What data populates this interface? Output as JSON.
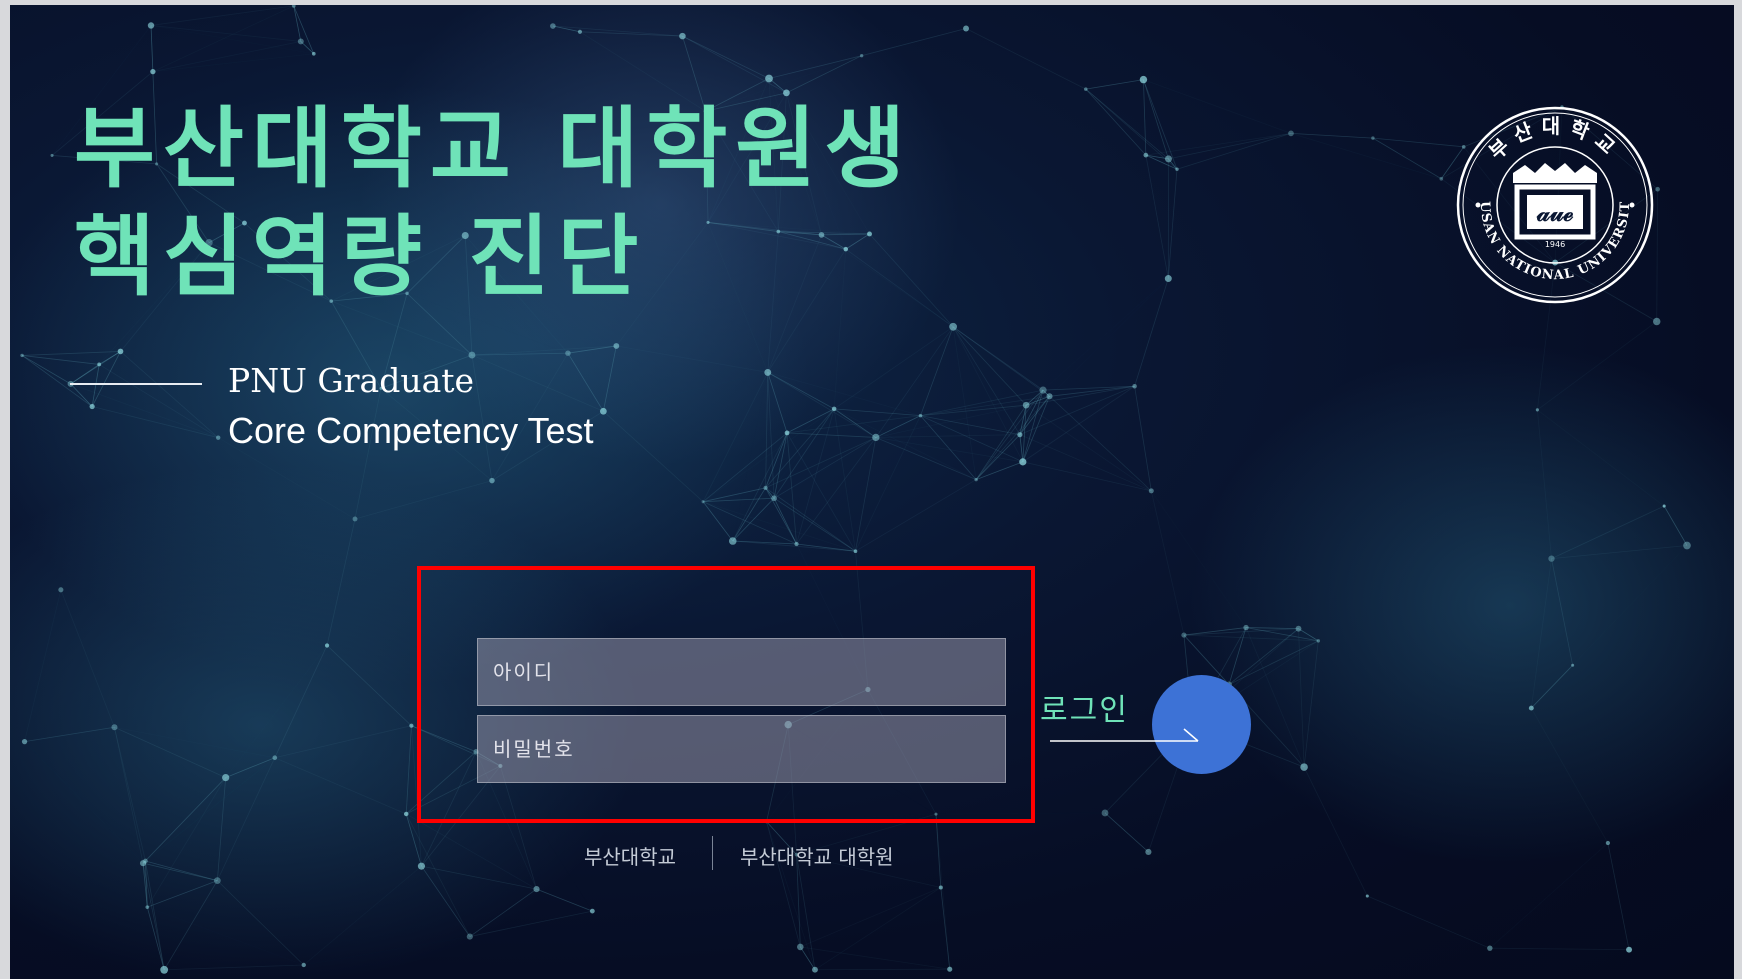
{
  "header": {
    "title_line_1": "부산대학교 대학원생",
    "title_line_2": "핵심역량 진단",
    "subtitle_en_1": "PNU Graduate",
    "subtitle_en_2": "Core Competency Test"
  },
  "logo": {
    "ring_text_top": "부산대학교",
    "ring_text_bottom": "PUSAN NATIONAL UNIVERSITY",
    "emblem_text": "𝒶𝓊ℯ",
    "year": "1946",
    "icon": "university-seal"
  },
  "login": {
    "id_placeholder": "아이디",
    "password_placeholder": "비밀번호",
    "button_label": "로그인"
  },
  "footer": {
    "links": [
      "부산대학교",
      "부산대학교 대학원"
    ]
  },
  "colors": {
    "title": "#6fe3b8",
    "button_circle": "#3d72d6",
    "highlight_border": "#ff0000",
    "background": "#060d24"
  }
}
